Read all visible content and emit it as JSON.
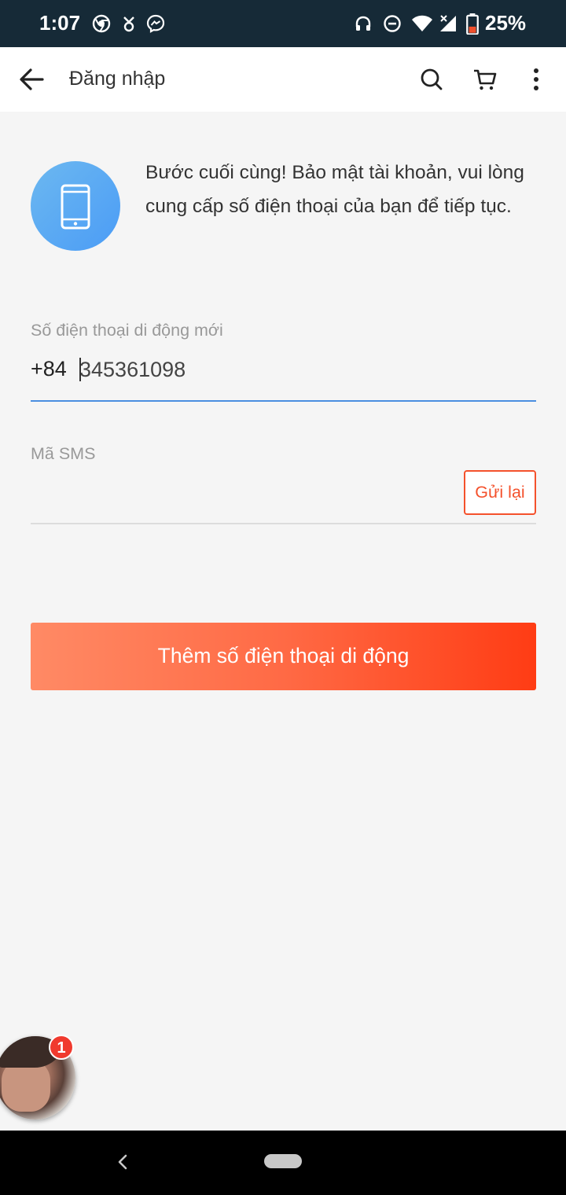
{
  "status_bar": {
    "time": "1:07",
    "battery": "25%",
    "icons": [
      "chrome-icon",
      "location-icon",
      "messenger-icon",
      "headphones-icon",
      "dnd-icon",
      "wifi-icon",
      "signal-icon",
      "battery-icon"
    ],
    "bg_color": "#162a37"
  },
  "app_bar": {
    "title": "Đăng nhập",
    "icons": [
      "back-arrow-icon",
      "search-icon",
      "cart-icon",
      "more-vert-icon"
    ]
  },
  "intro": {
    "text": "Bước cuối cùng! Bảo mật tài khoản, vui lòng cung cấp số điện thoại của bạn để tiếp tục.",
    "icon": "smartphone-icon"
  },
  "phone_field": {
    "label": "Số điện thoại di động mới",
    "prefix": "+84",
    "value": "345361098",
    "underline_color": "#4a8ee0"
  },
  "sms_field": {
    "label": "Mã SMS",
    "value": "",
    "resend_label": "Gửi lại",
    "accent_color": "#f4512c"
  },
  "submit": {
    "label": "Thêm số điện thoại di động",
    "gradient": [
      "#ff8a65",
      "#ff3c14"
    ]
  },
  "chat_head": {
    "badge_count": "1",
    "badge_color": "#f03a2e"
  }
}
